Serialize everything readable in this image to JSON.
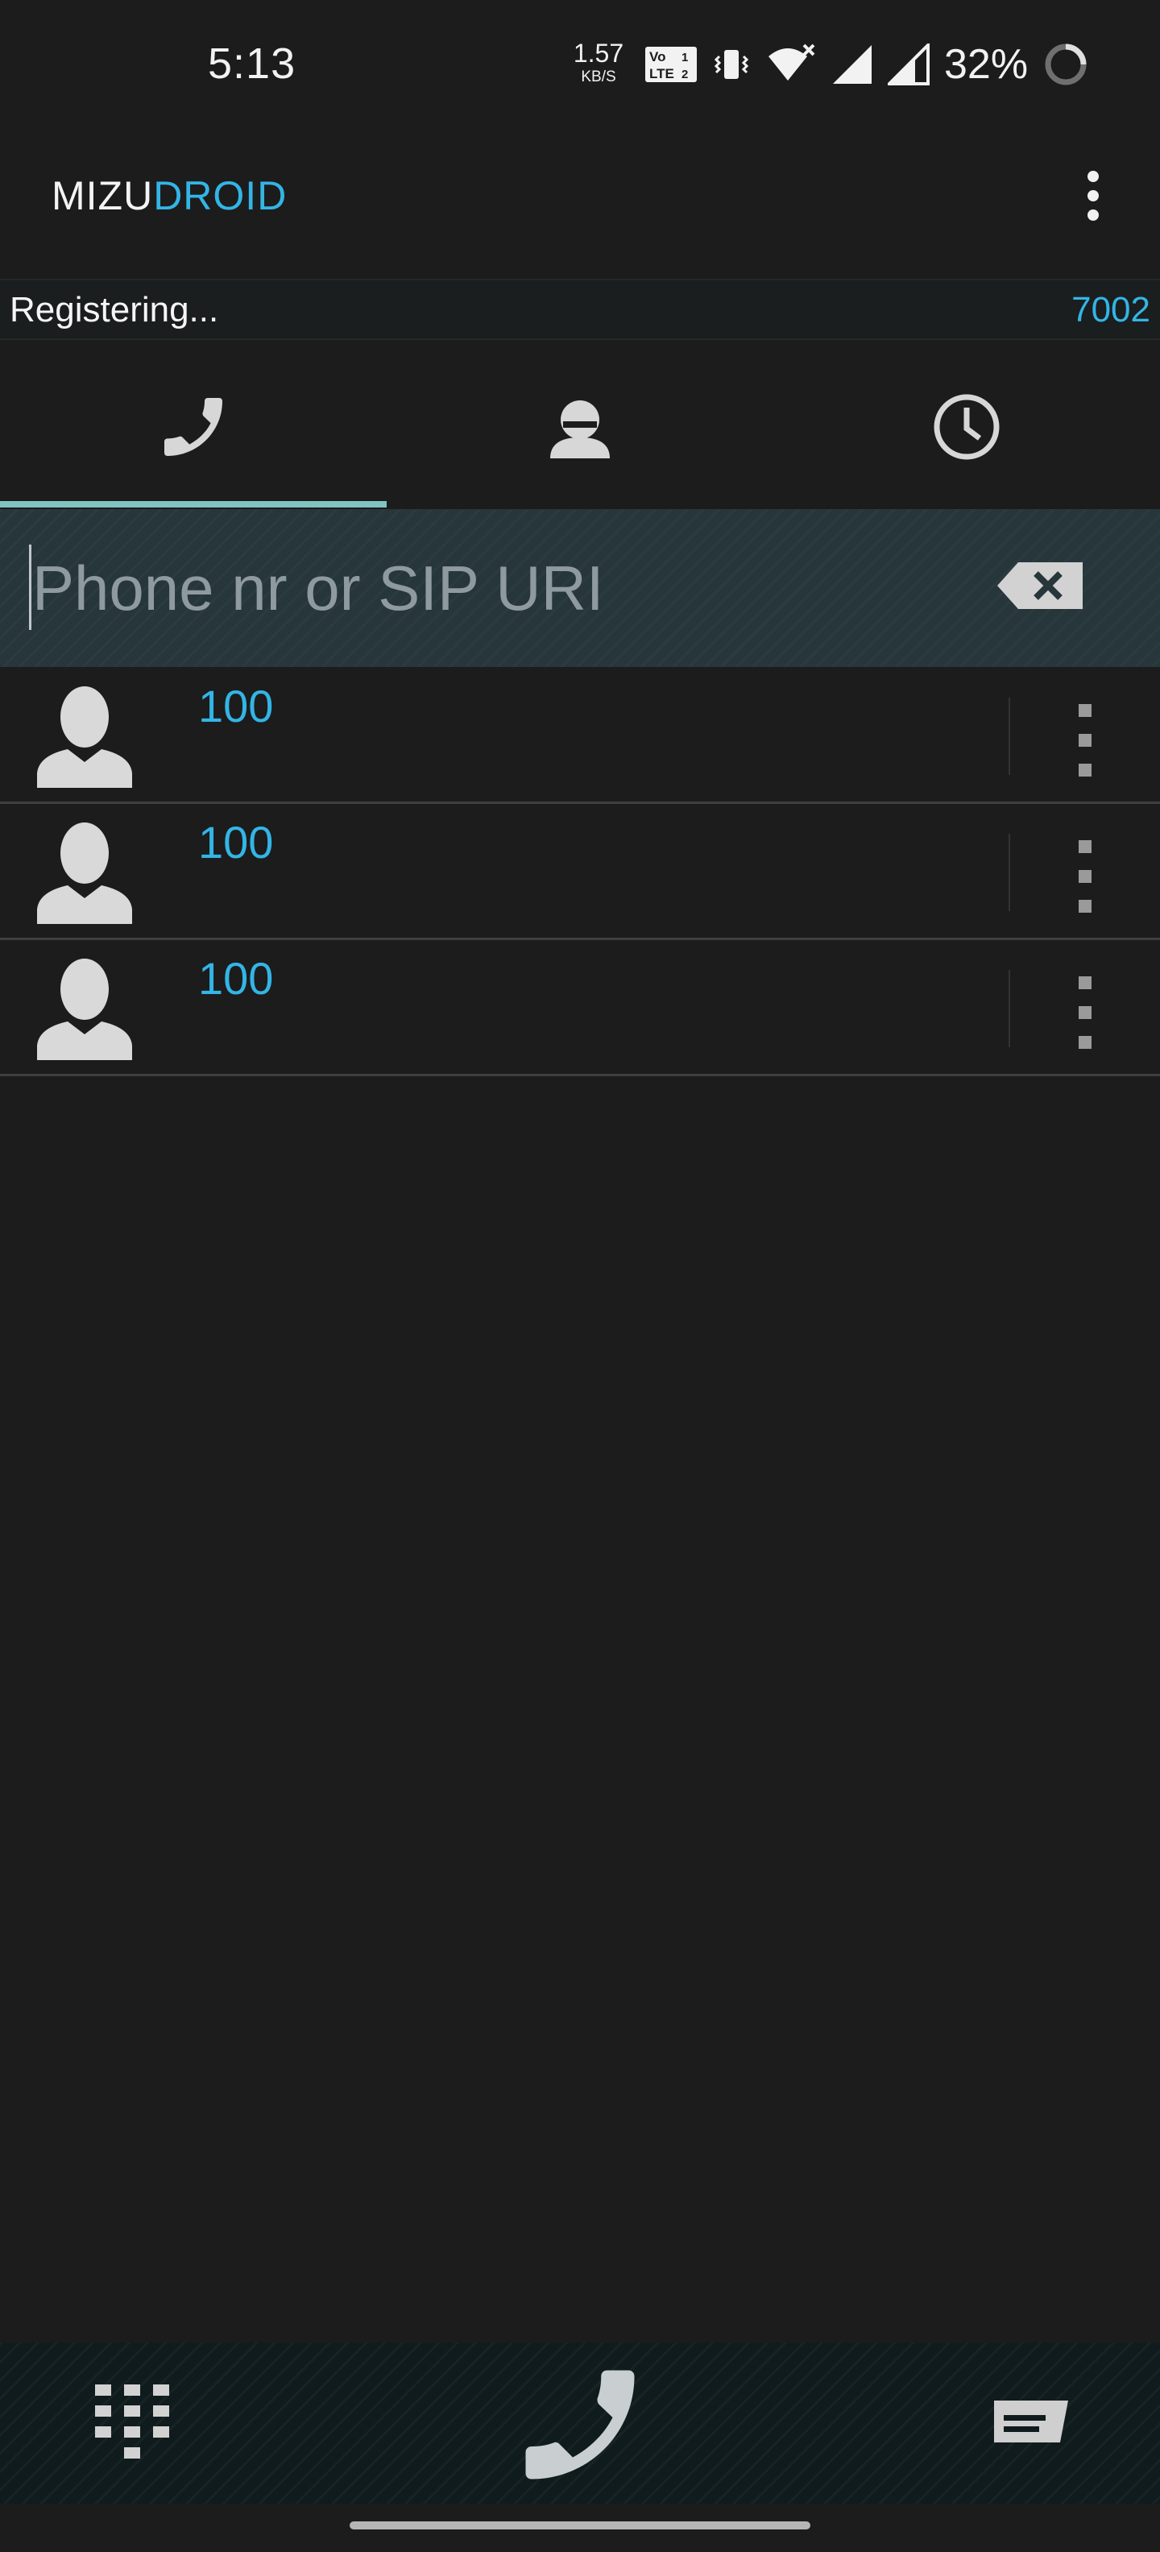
{
  "status_bar": {
    "time": "5:13",
    "net_speed_value": "1.57",
    "net_speed_unit": "KB/S",
    "battery_percent": "32%",
    "icons": [
      "volte-icon",
      "vibrate-icon",
      "wifi-icon",
      "signal-icon",
      "signal-icon",
      "battery-saver-ring-icon"
    ]
  },
  "app_bar": {
    "title_part1": "MIZU",
    "title_part2": "DROID",
    "title_part2_color": "#33b5e5"
  },
  "registration": {
    "status": "Registering...",
    "account": "7002"
  },
  "tabs": [
    {
      "icon": "phone-icon",
      "selected": true
    },
    {
      "icon": "contact-icon",
      "selected": false
    },
    {
      "icon": "history-clock-icon",
      "selected": false
    }
  ],
  "dial_input": {
    "value": "",
    "placeholder": "Phone nr or SIP URI"
  },
  "recent_list": [
    {
      "name": "100"
    },
    {
      "name": "100"
    },
    {
      "name": "100"
    }
  ],
  "bottom_bar": {
    "actions": [
      "dialpad-icon",
      "call-icon",
      "message-icon"
    ]
  },
  "colors": {
    "background": "#1c1c1c",
    "accent": "#33b5e5",
    "tab_indicator": "#7fc4c0"
  }
}
